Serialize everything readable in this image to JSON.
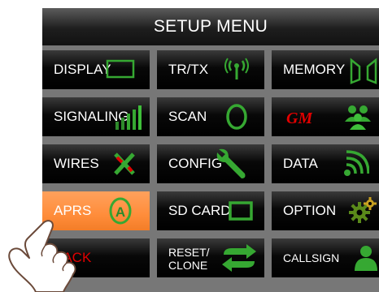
{
  "menu": {
    "title": "SETUP MENU",
    "items": [
      {
        "label": "DISPLAY",
        "icon": "display-frame-icon"
      },
      {
        "label": "TR/TX",
        "icon": "antenna-icon"
      },
      {
        "label": "MEMORY",
        "icon": "memory-bracket-icon"
      },
      {
        "label": "SIGNALING",
        "icon": "signal-bars-icon"
      },
      {
        "label": "SCAN",
        "icon": "scan-ring-icon"
      },
      {
        "label": "",
        "icon": "gm-logo-icon",
        "logo_text": "GM"
      },
      {
        "label": "WIRES",
        "icon": "wires-x-icon"
      },
      {
        "label": "CONFIG",
        "icon": "wrench-icon"
      },
      {
        "label": "DATA",
        "icon": "data-wave-icon"
      },
      {
        "label": "APRS",
        "icon": "aprs-a-icon",
        "icon_letter": "A",
        "active": true
      },
      {
        "label": "SD CARD",
        "icon": "sd-card-icon"
      },
      {
        "label": "OPTION",
        "icon": "gear-icon"
      },
      {
        "label": "BACK",
        "icon": "none"
      },
      {
        "label": "RESET/\nCLONE",
        "icon": "reset-arrows-icon"
      },
      {
        "label": "CALLSIGN",
        "icon": "user-icon"
      }
    ]
  },
  "colors": {
    "background": "#333333",
    "button": "#000000",
    "active_button": "#ff8d3b",
    "icon_green": "#36a832",
    "back_text": "#e10000",
    "gm_red": "#e10000"
  }
}
